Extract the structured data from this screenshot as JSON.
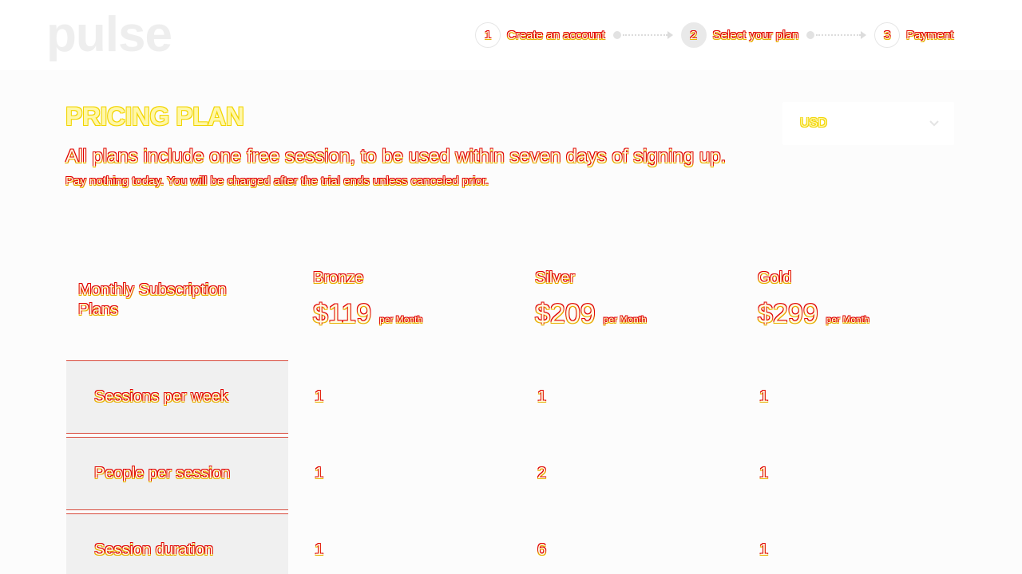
{
  "brand": {
    "logo": "pulse"
  },
  "steps": [
    {
      "num": "1",
      "label": "Create an account",
      "active": false
    },
    {
      "num": "2",
      "label": "Select your plan",
      "active": true
    },
    {
      "num": "3",
      "label": "Payment",
      "active": false
    }
  ],
  "intro": {
    "title": "PRICING PLAN",
    "subtitle": "All plans include one free session, to be used within seven days of signing up.",
    "note": "Pay nothing today. You will be charged after the trial ends unless canceled prior."
  },
  "currency": {
    "value": "USD",
    "icon": "chevron-down-icon"
  },
  "table": {
    "header_label": "Monthly Subscription Plans",
    "plans": [
      {
        "name": "Bronze",
        "price": "$119",
        "period": "per Month"
      },
      {
        "name": "Silver",
        "price": "$209",
        "period": "per Month"
      },
      {
        "name": "Gold",
        "price": "$299",
        "period": "per Month"
      }
    ],
    "rows": [
      {
        "label": "Sessions per week",
        "values": [
          "1",
          "1",
          "1"
        ]
      },
      {
        "label": "People per session",
        "values": [
          "1",
          "2",
          "1"
        ]
      },
      {
        "label": "Session duration",
        "values": [
          "1",
          "6",
          "1"
        ]
      }
    ]
  },
  "colors": {
    "outline_red": "#e00000",
    "outline_yellow": "#e8b000",
    "row_bg": "#f0f0f0",
    "row_border": "#d84a3c"
  }
}
